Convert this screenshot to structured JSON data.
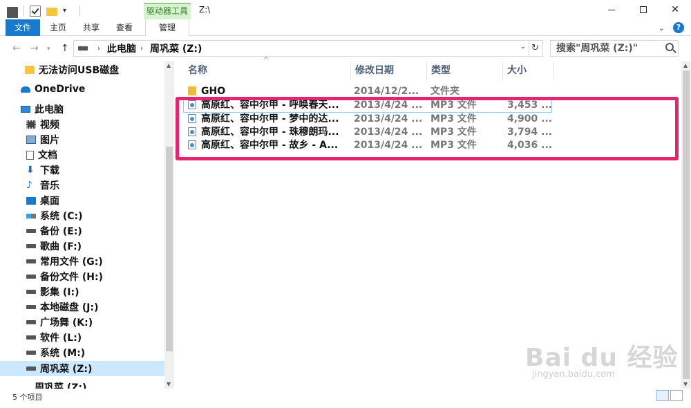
{
  "window": {
    "title": "Z:\\",
    "context_tab_group": "驱动器工具"
  },
  "ribbon": {
    "tabs": [
      "文件",
      "主页",
      "共享",
      "查看",
      "管理"
    ]
  },
  "address": {
    "crumbs": [
      "此电脑",
      "周巩菜 (Z:)"
    ],
    "search_placeholder": "搜索\"周巩菜 (Z:)\""
  },
  "navpane": {
    "items": [
      {
        "label": "无法访问USB磁盘",
        "icon": "folder-icon"
      },
      {
        "label": "OneDrive",
        "icon": "onedrive-icon"
      },
      {
        "label": "此电脑",
        "icon": "computer-icon"
      },
      {
        "label": "视频",
        "icon": "video-icon"
      },
      {
        "label": "图片",
        "icon": "pictures-icon"
      },
      {
        "label": "文档",
        "icon": "documents-icon"
      },
      {
        "label": "下载",
        "icon": "download-icon"
      },
      {
        "label": "音乐",
        "icon": "music-icon"
      },
      {
        "label": "桌面",
        "icon": "desktop-icon"
      },
      {
        "label": "系统 (C:)",
        "icon": "system-drive-icon"
      },
      {
        "label": "备份 (E:)",
        "icon": "drive-icon"
      },
      {
        "label": "歌曲 (F:)",
        "icon": "drive-icon"
      },
      {
        "label": "常用文件 (G:)",
        "icon": "drive-icon"
      },
      {
        "label": "备份文件  (H:)",
        "icon": "drive-icon"
      },
      {
        "label": "影集 (I:)",
        "icon": "drive-icon"
      },
      {
        "label": "本地磁盘 (J:)",
        "icon": "drive-icon"
      },
      {
        "label": "广场舞 (K:)",
        "icon": "drive-icon"
      },
      {
        "label": "软件 (L:)",
        "icon": "drive-icon"
      },
      {
        "label": "系统 (M:)",
        "icon": "drive-icon"
      },
      {
        "label": "周巩菜 (Z:)",
        "icon": "drive-icon",
        "selected": true
      },
      {
        "label": "周巩菜 (Z:)",
        "icon": "drive-icon"
      }
    ]
  },
  "filelist": {
    "columns": [
      "名称",
      "修改日期",
      "类型",
      "大小"
    ],
    "rows": [
      {
        "name": "GHO",
        "date": "2014/12/2...",
        "type": "文件夹",
        "size": "",
        "kind": "folder"
      },
      {
        "name": "高原红、容中尔甲 - 呼唤春天...",
        "date": "2013/4/24 ...",
        "type": "MP3 文件",
        "size": "3,453 ...",
        "kind": "mp3"
      },
      {
        "name": "高原红、容中尔甲 - 梦中的达...",
        "date": "2013/4/24 ...",
        "type": "MP3 文件",
        "size": "4,900 ...",
        "kind": "mp3"
      },
      {
        "name": "高原红、容中尔甲 - 珠穆朗玛...",
        "date": "2013/4/24 ...",
        "type": "MP3 文件",
        "size": "3,794 ...",
        "kind": "mp3"
      },
      {
        "name": "高原红、容中尔甲 - 故乡 - A...",
        "date": "2013/4/24 ...",
        "type": "MP3 文件",
        "size": "4,036 ...",
        "kind": "mp3"
      }
    ]
  },
  "status": {
    "item_count": "5 个项目"
  },
  "watermark": {
    "brand": "Bai du 经验",
    "url": "jingyan.baidu.com"
  },
  "colors": {
    "accent": "#1979ca",
    "selection": "#cce8ff",
    "highlight": "#e3266f",
    "context_tab": "#d7f2d0"
  }
}
